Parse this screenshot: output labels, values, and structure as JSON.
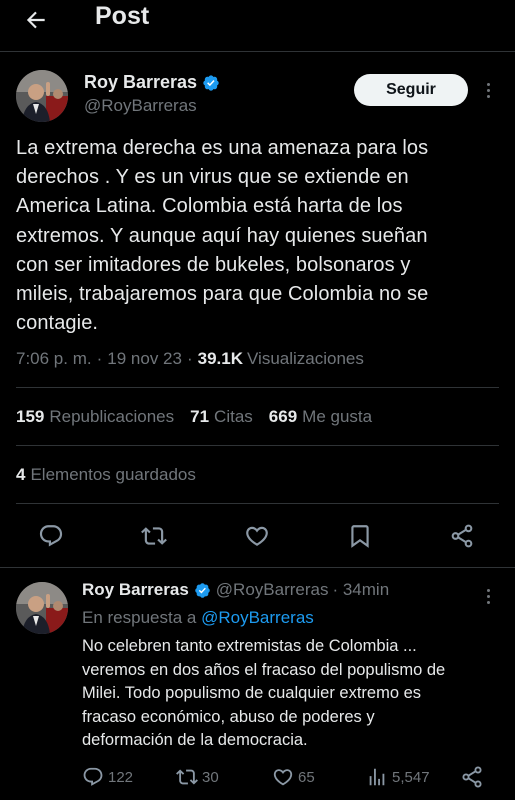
{
  "header": {
    "title": "Post",
    "back_icon": "arrow-left-icon"
  },
  "post": {
    "author": {
      "name": "Roy Barreras",
      "handle": "@RoyBarreras",
      "verified": true
    },
    "follow_label": "Seguir",
    "text": "La extrema derecha es una amenaza para los\nderechos . Y es un virus que se extiende en\nAmerica Latina. Colombia está harta de los\nextremos. Y aunque aquí hay quienes sueñan\ncon ser imitadores de bukeles, bolsonaros y\nmileis, trabajaremos para que Colombia no se\ncontagie.",
    "time": "7:06 p. m.",
    "separator": "·",
    "date": "19 nov 23",
    "views": "39.1K",
    "views_label": "Visualizaciones",
    "stats": {
      "reposts": "159",
      "reposts_label": "Republicaciones",
      "quotes": "71",
      "quotes_label": "Citas",
      "likes": "669",
      "likes_label": "Me gusta"
    },
    "bookmarks": "4",
    "bookmarks_label": "Elementos guardados"
  },
  "reply": {
    "author": {
      "name": "Roy Barreras",
      "handle": "@RoyBarreras",
      "verified": true
    },
    "time": "· 34min",
    "reply_to_label": "En respuesta a",
    "reply_to_handle": "@RoyBarreras",
    "text": "No celebren tanto extremistas de Colombia ...\nveremos en dos años el fracaso del populismo de\nMilei. Todo populismo de cualquier extremo es\nfracaso económico, abuso de poderes y\ndeformación de la democracia.",
    "counts": {
      "replies": "122",
      "reposts": "30",
      "likes": "65",
      "views": "5,547"
    }
  },
  "colors": {
    "background": "#000000",
    "text": "#e7e9ea",
    "muted": "#71767b",
    "accent": "#1d9bf0",
    "divider": "#2f3336"
  }
}
